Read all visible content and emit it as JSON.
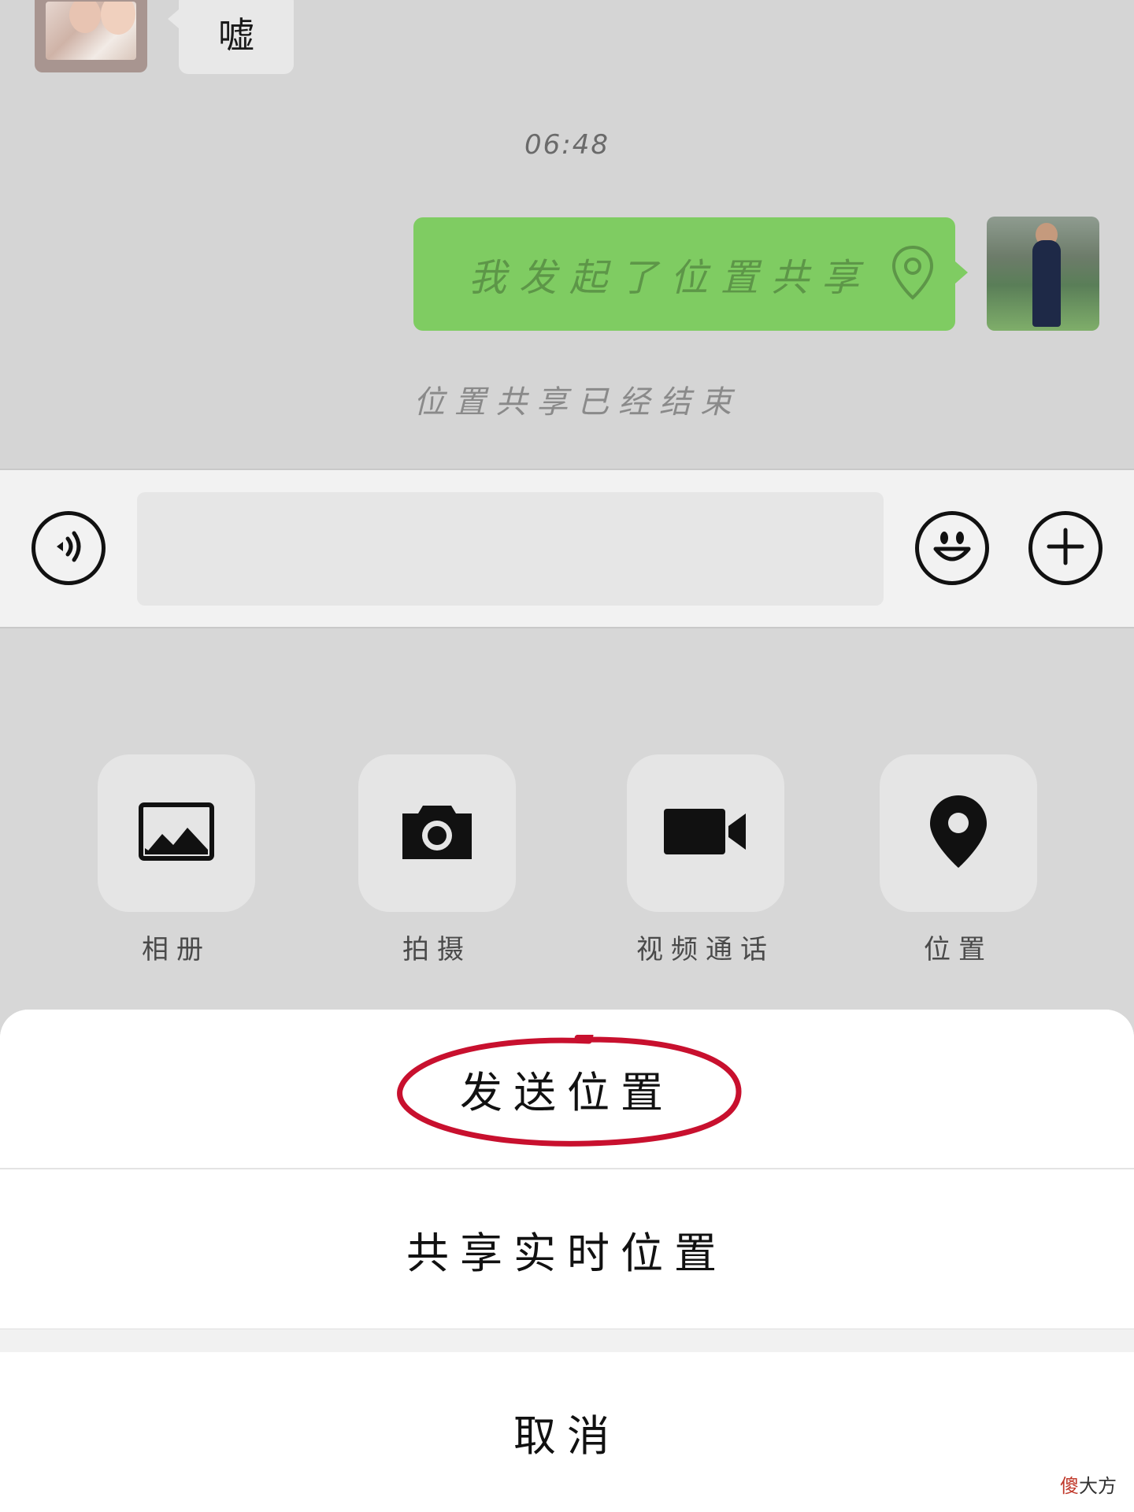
{
  "chat": {
    "incoming_message": "嘘",
    "timestamp": "06:48",
    "outgoing_message": "我发起了位置共享",
    "system_note": "位置共享已经结束"
  },
  "input_bar": {
    "text_value": "",
    "voice_icon": "voice-icon",
    "emoji_icon": "emoji-icon",
    "plus_icon": "plus-icon"
  },
  "features": [
    {
      "label": "相册",
      "icon": "photo-album-icon"
    },
    {
      "label": "拍摄",
      "icon": "camera-icon"
    },
    {
      "label": "视频通话",
      "icon": "video-call-icon"
    },
    {
      "label": "位置",
      "icon": "location-icon"
    }
  ],
  "action_sheet": {
    "send_location": "发送位置",
    "share_live_location": "共享实时位置",
    "cancel": "取消"
  },
  "watermark": {
    "part1": "傻",
    "part2": "大方"
  },
  "colors": {
    "bubble_green": "#7fcc62",
    "annotation_red": "#c8102e"
  }
}
